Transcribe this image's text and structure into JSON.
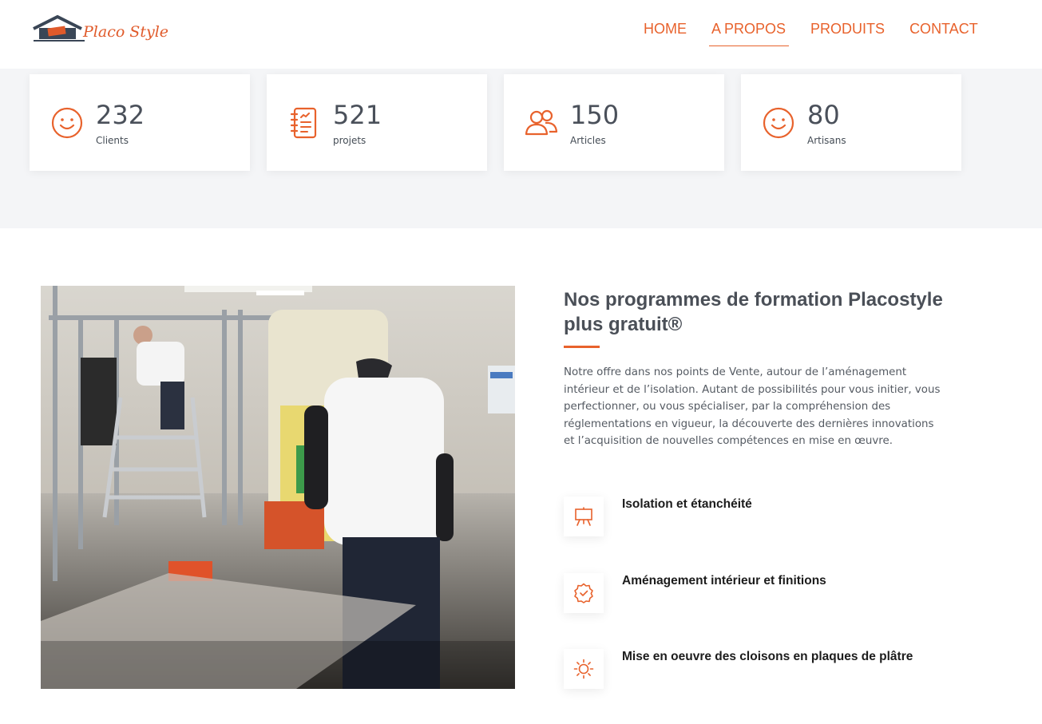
{
  "header": {
    "logo_text": "Placo Style",
    "nav": [
      {
        "label": "HOME",
        "active": false
      },
      {
        "label": "A PROPOS",
        "active": true
      },
      {
        "label": "PRODUITS",
        "active": false
      },
      {
        "label": "CONTACT",
        "active": false
      }
    ]
  },
  "stats": [
    {
      "value": "232",
      "label": "Clients",
      "icon": "smile-icon"
    },
    {
      "value": "521",
      "label": "projets",
      "icon": "journal-icon"
    },
    {
      "value": "150",
      "label": "Articles",
      "icon": "people-icon"
    },
    {
      "value": "80",
      "label": "Artisans",
      "icon": "smile-icon"
    }
  ],
  "about": {
    "title": "Nos programmes de formation Placostyle plus gratuit®",
    "paragraph": "Notre offre dans nos points de Vente, autour de l’aménagement intérieur et de l’isolation. Autant de possibilités pour vous initier, vous perfectionner, ou vous spécialiser, par la compréhension des réglementations en vigueur, la découverte des dernières innovations et l’acquisition de nouvelles compétences en mise en œuvre.",
    "features": [
      {
        "title": "Isolation et étanchéité",
        "icon": "easel-icon"
      },
      {
        "title": "Aménagement intérieur et finitions",
        "icon": "patch-check-icon"
      },
      {
        "title": "Mise en oeuvre des cloisons en plaques de plâtre",
        "icon": "sun-icon"
      }
    ]
  },
  "colors": {
    "accent": "#e8622c",
    "band": "#f4f5f7",
    "text": "#444c55"
  }
}
